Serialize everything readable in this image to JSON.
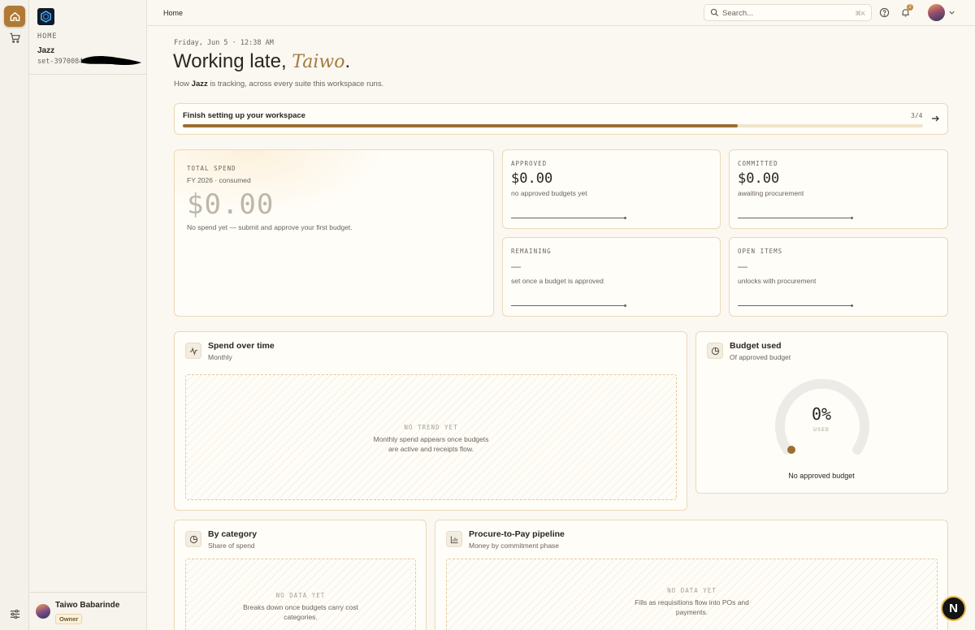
{
  "sidebar": {
    "section_label": "HOME",
    "workspace_name": "Jazz",
    "workspace_id": "set-39700844",
    "user_name": "Taiwo Babarinde",
    "user_role": "Owner"
  },
  "topbar": {
    "title": "Home",
    "search_placeholder": "Search...",
    "search_shortcut": "⌘K",
    "notification_count": "2"
  },
  "greeting": {
    "meta": "Friday, Jun 5 · 12:38 AM",
    "prefix": "Working late, ",
    "name": "Taiwo",
    "suffix": ".",
    "sub_prefix": "How ",
    "sub_brand": "Jazz",
    "sub_suffix": " is tracking, across every suite this workspace runs."
  },
  "setup": {
    "label": "Finish setting up your workspace",
    "count": "3/4",
    "progress": 0.75
  },
  "total": {
    "kicker": "TOTAL SPEND",
    "period": "FY 2026 · consumed",
    "value": "$0.00",
    "note": "No spend yet — submit and approve your first budget."
  },
  "stats": [
    {
      "kicker": "APPROVED",
      "value": "$0.00",
      "sub": "no approved budgets yet"
    },
    {
      "kicker": "COMMITTED",
      "value": "$0.00",
      "sub": "awaiting procurement"
    },
    {
      "kicker": "REMAINING",
      "value": "—",
      "sub": "set once a budget is approved"
    },
    {
      "kicker": "OPEN ITEMS",
      "value": "—",
      "sub": "unlocks with procurement"
    }
  ],
  "spend_over_time": {
    "title": "Spend over time",
    "sub": "Monthly",
    "empty_title": "NO TREND YET",
    "empty_text_1": "Monthly spend appears once budgets",
    "empty_text_2": "are active and receipts flow."
  },
  "budget_used": {
    "title": "Budget used",
    "sub": "Of approved budget",
    "percent": "0%",
    "used_label": "USED",
    "footer": "No approved budget",
    "value": 0
  },
  "by_category": {
    "title": "By category",
    "sub": "Share of spend",
    "empty_title": "NO DATA YET",
    "empty_text_1": "Breaks down once budgets carry cost",
    "empty_text_2": "categories."
  },
  "pipeline": {
    "title": "Procure-to-Pay pipeline",
    "sub": "Money by commitment phase",
    "empty_title": "NO DATA YET",
    "empty_text_1": "Fills as requisitions flow into POs and",
    "empty_text_2": "payments."
  },
  "fab": {
    "label": "N"
  },
  "colors": {
    "accent": "#a37a43",
    "progress": "#9c6e32",
    "card_border": "#ead9b9",
    "background": "#fbf8f1"
  }
}
